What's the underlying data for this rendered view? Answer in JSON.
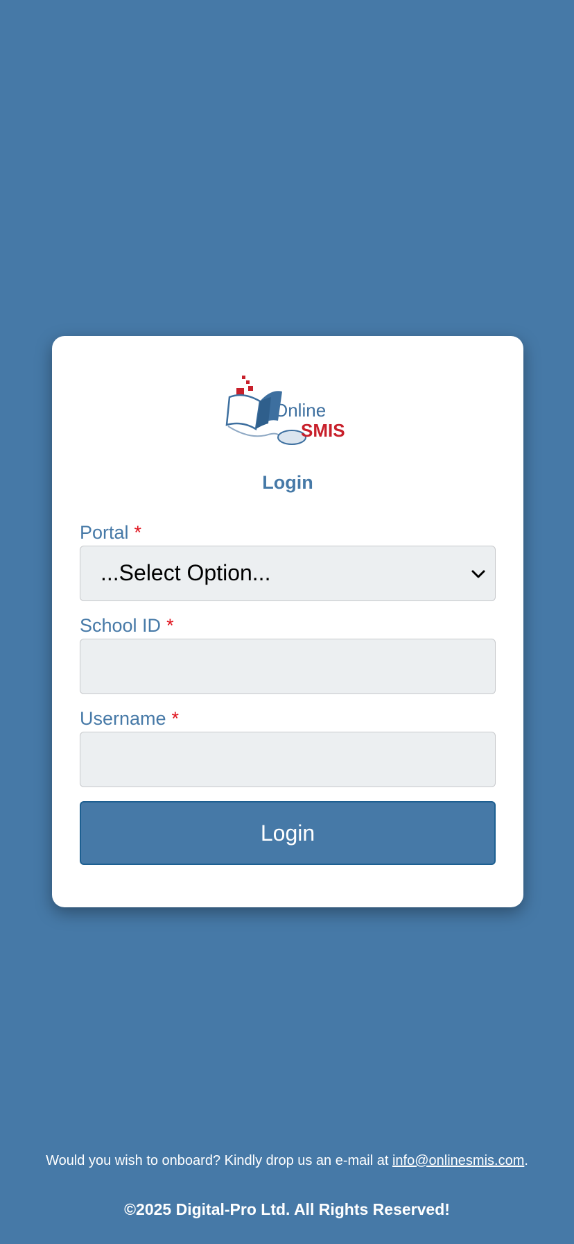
{
  "colors": {
    "background": "#4679a7",
    "card": "#ffffff",
    "accent": "#4679a7",
    "required": "#e0141e",
    "input_bg": "#eceff1"
  },
  "logo": {
    "line1": "Online",
    "line2": "SMIS",
    "icon": "book-mouse-logo"
  },
  "form": {
    "heading": "Login",
    "required_mark": "*",
    "portal": {
      "label": "Portal",
      "selected": "...Select Option..."
    },
    "school_id": {
      "label": "School ID",
      "value": ""
    },
    "username": {
      "label": "Username",
      "value": ""
    },
    "submit_label": "Login"
  },
  "footer": {
    "onboard_text": "Would you wish to onboard? Kindly drop us an e-mail at ",
    "email": "info@onlinesmis.com",
    "period": ".",
    "copyright": "©2025 Digital-Pro Ltd. All Rights Reserved!"
  }
}
